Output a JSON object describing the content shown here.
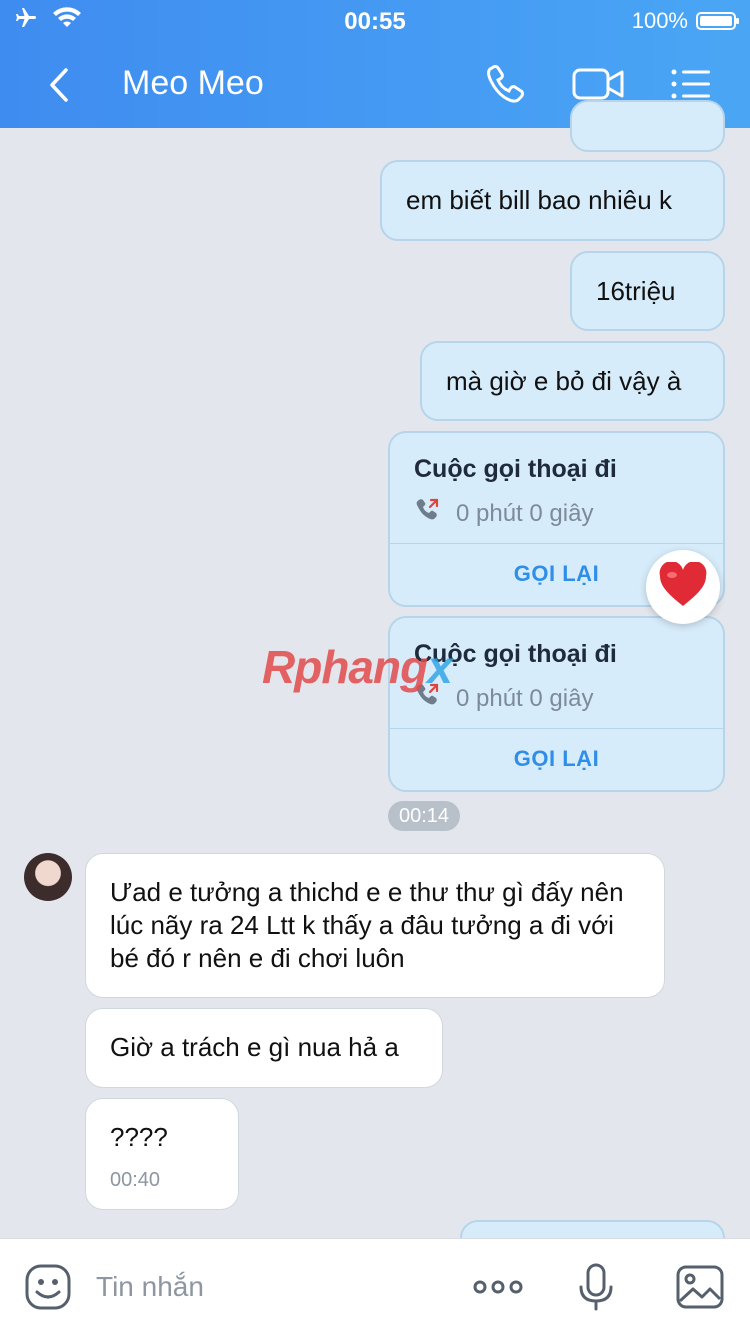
{
  "status_bar": {
    "time": "00:55",
    "battery": "100%"
  },
  "header": {
    "title": "Meo Meo"
  },
  "messages_out": [
    {
      "text": "em biết bill bao nhiêu k"
    },
    {
      "text": "16triệu"
    },
    {
      "text": "mà giờ e bỏ đi vậy à"
    }
  ],
  "calls": [
    {
      "title": "Cuộc gọi thoại đi",
      "duration": "0 phút 0 giây",
      "action": "GỌI LẠI"
    },
    {
      "title": "Cuộc gọi thoại đi",
      "duration": "0 phút 0 giây",
      "action": "GỌI LẠI"
    }
  ],
  "time_badge": "00:14",
  "messages_in": [
    {
      "text": "Ưad e tưởng a thichd e e thư thư gì đấy nên lúc nãy ra 24 Ltt k thấy a đâu tưởng a đi với bé đó r nên e đi chơi luôn"
    },
    {
      "text": "Giờ a trách e gì nua hả a"
    },
    {
      "text": "????",
      "time": "00:40"
    }
  ],
  "watermark": {
    "part1": "Rphang",
    "part2": "x"
  },
  "composer": {
    "placeholder": "Tin nhắn"
  },
  "colors": {
    "header": "#4aa6f5",
    "bubble_out": "#d7ecfb",
    "link": "#2f8ee8"
  },
  "icons": [
    "airplane-icon",
    "wifi-icon",
    "back-icon",
    "phone-icon",
    "video-icon",
    "menu-icon",
    "call-outgoing-icon",
    "heart-icon",
    "sticker-icon",
    "more-icon",
    "mic-icon",
    "image-icon"
  ]
}
